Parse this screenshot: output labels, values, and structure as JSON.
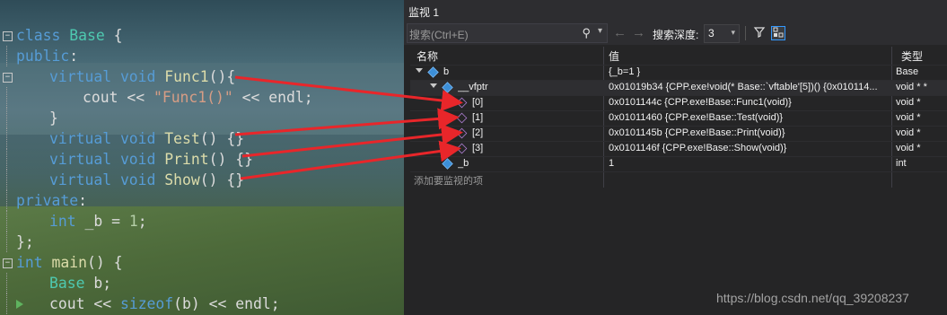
{
  "code_lines": [
    {
      "id": "l1",
      "parts": [
        [
          "kw",
          "class "
        ],
        [
          "ty",
          "Base"
        ],
        [
          "pl",
          " {"
        ]
      ]
    },
    {
      "id": "l2",
      "parts": [
        [
          "kw",
          "public"
        ],
        [
          "pl",
          ":"
        ]
      ]
    },
    {
      "id": "l3",
      "parts": [
        [
          "kw",
          "virtual void "
        ],
        [
          "fn",
          "Func1"
        ],
        [
          "pl",
          "(){"
        ]
      ]
    },
    {
      "id": "l4",
      "parts": [
        [
          "pl",
          "cout << "
        ],
        [
          "st",
          "\"Func1()\""
        ],
        [
          "pl",
          " << endl;"
        ]
      ]
    },
    {
      "id": "l5",
      "parts": [
        [
          "pl",
          "}"
        ]
      ]
    },
    {
      "id": "l6",
      "parts": [
        [
          "kw",
          "virtual void "
        ],
        [
          "fn",
          "Test"
        ],
        [
          "pl",
          "() {}"
        ]
      ]
    },
    {
      "id": "l7",
      "parts": [
        [
          "kw",
          "virtual void "
        ],
        [
          "fn",
          "Print"
        ],
        [
          "pl",
          "() {}"
        ]
      ]
    },
    {
      "id": "l8",
      "parts": [
        [
          "kw",
          "virtual void "
        ],
        [
          "fn",
          "Show"
        ],
        [
          "pl",
          "() {}"
        ]
      ]
    },
    {
      "id": "l9",
      "parts": [
        [
          "kw",
          "private"
        ],
        [
          "pl",
          ":"
        ]
      ]
    },
    {
      "id": "l10",
      "parts": [
        [
          "kw",
          "int "
        ],
        [
          "pl",
          "_b = "
        ],
        [
          "nm",
          "1"
        ],
        [
          "pl",
          ";"
        ]
      ]
    },
    {
      "id": "l11",
      "parts": [
        [
          "pl",
          "};"
        ]
      ]
    },
    {
      "id": "l12",
      "parts": [
        [
          "kw",
          "int "
        ],
        [
          "fn",
          "main"
        ],
        [
          "pl",
          "() {"
        ]
      ]
    },
    {
      "id": "l13",
      "parts": [
        [
          "ty",
          "Base "
        ],
        [
          "pl",
          "b;"
        ]
      ]
    },
    {
      "id": "l14",
      "parts": [
        [
          "pl",
          "cout << "
        ],
        [
          "kw",
          "sizeof"
        ],
        [
          "pl",
          "(b) << endl;"
        ]
      ]
    }
  ],
  "watch": {
    "title": "监视 1",
    "search_placeholder": "搜索(Ctrl+E)",
    "depth_label": "搜索深度:",
    "depth_value": "3",
    "columns": [
      "名称",
      "值",
      "类型"
    ],
    "rows": [
      {
        "name": "b",
        "value": "{_b=1 }",
        "type": "Base"
      },
      {
        "name": "__vfptr",
        "value": "0x01019b34 {CPP.exe!void(* Base::`vftable'[5])() {0x010114...",
        "type": "void * *"
      },
      {
        "name": "[0]",
        "value": "0x0101144c {CPP.exe!Base::Func1(void)}",
        "type": "void *"
      },
      {
        "name": "[1]",
        "value": "0x01011460 {CPP.exe!Base::Test(void)}",
        "type": "void *"
      },
      {
        "name": "[2]",
        "value": "0x0101145b {CPP.exe!Base::Print(void)}",
        "type": "void *"
      },
      {
        "name": "[3]",
        "value": "0x0101146f {CPP.exe!Base::Show(void)}",
        "type": "void *"
      },
      {
        "name": "_b",
        "value": "1",
        "type": "int"
      }
    ],
    "add_placeholder": "添加要监视的项"
  },
  "watermark": "https://blog.csdn.net/qq_39208237",
  "colors": {
    "arrow": "#e8262a",
    "keyword": "#569cd6",
    "function": "#dcdcaa",
    "string": "#d69d85"
  }
}
